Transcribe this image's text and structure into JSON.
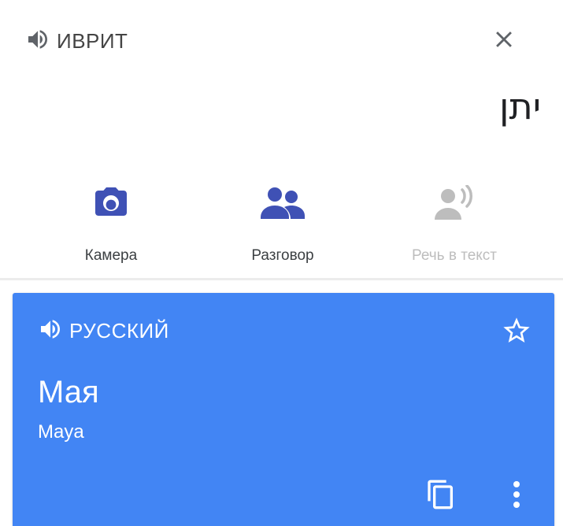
{
  "source": {
    "language": "ИВРИТ",
    "text": "יתן",
    "speaker_icon": "volume-icon",
    "close_icon": "close-icon"
  },
  "actions": [
    {
      "label": "Камера",
      "icon": "camera-icon",
      "enabled": true
    },
    {
      "label": "Разговор",
      "icon": "conversation-icon",
      "enabled": true
    },
    {
      "label": "Речь в текст",
      "icon": "speech-to-text-icon",
      "enabled": false
    }
  ],
  "result": {
    "language": "РУССКИЙ",
    "translation": "Мая",
    "transliteration": "Maya",
    "speaker_icon": "volume-icon",
    "star_icon": "star-outline-icon",
    "copy_icon": "copy-icon",
    "more_icon": "more-vert-icon"
  },
  "colors": {
    "accent": "#3f51b5",
    "card": "#4285f4",
    "disabled": "#bdbdbd",
    "text": "#202124"
  }
}
